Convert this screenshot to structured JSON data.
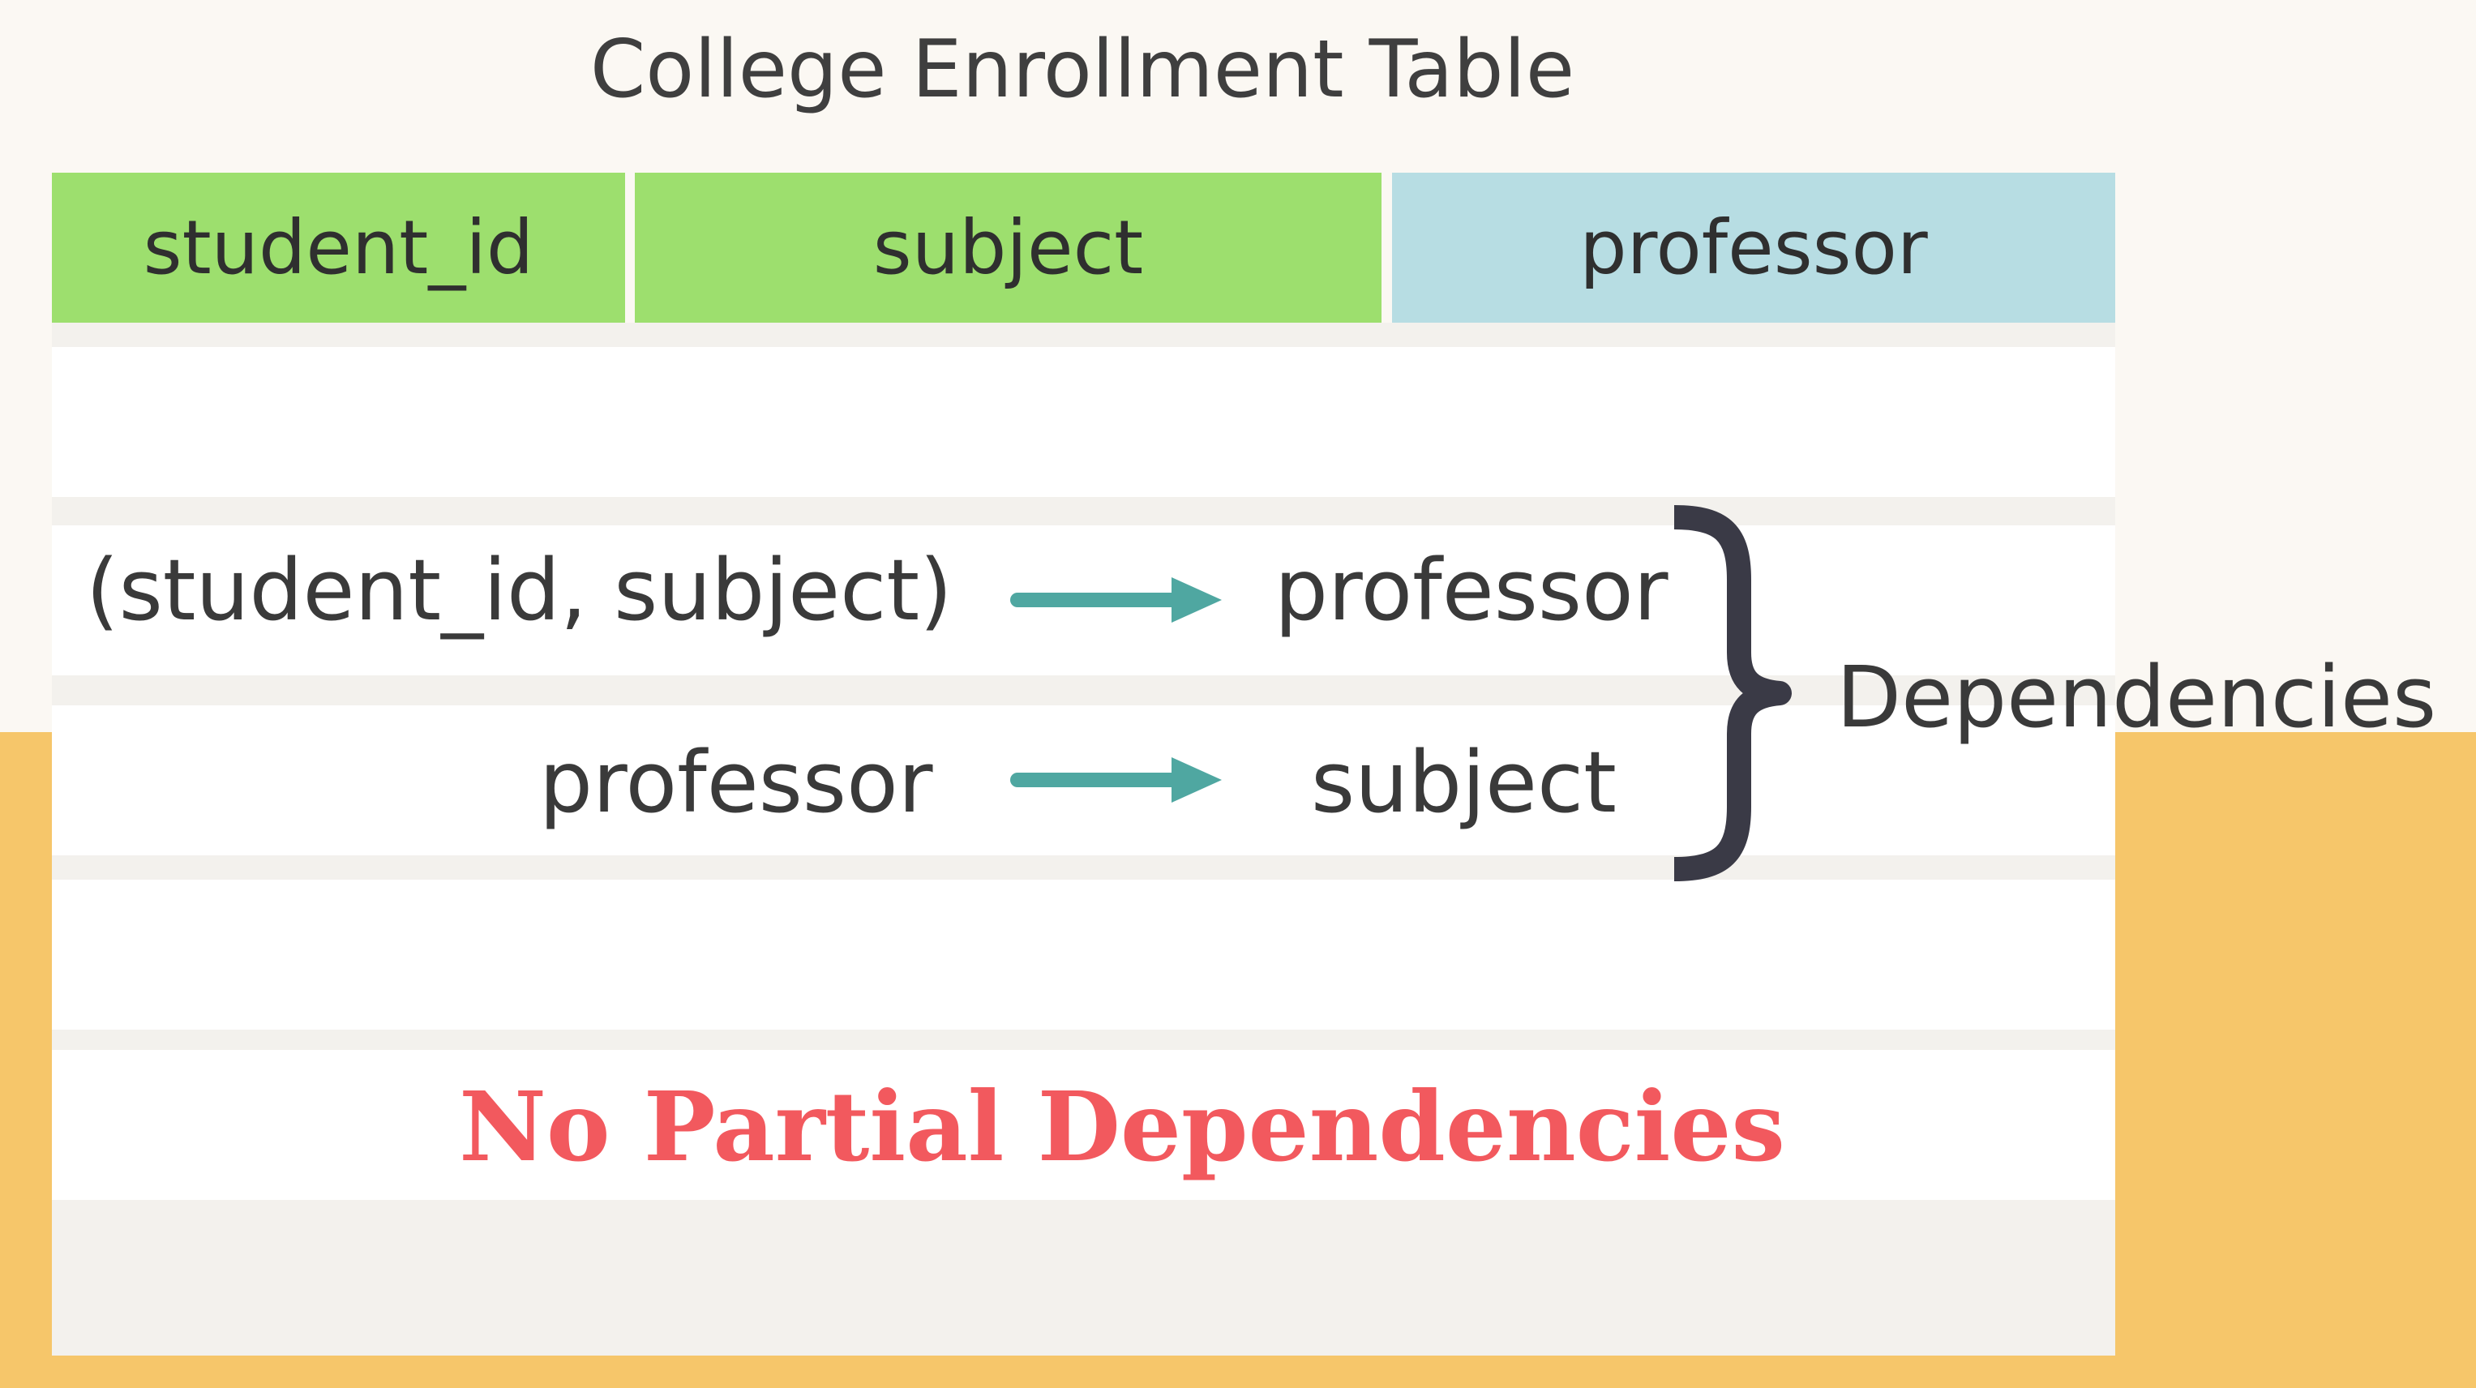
{
  "title": "College Enrollment Table",
  "columns": [
    {
      "label": "student_id",
      "key_part": true
    },
    {
      "label": "subject",
      "key_part": true
    },
    {
      "label": "professor",
      "key_part": false
    }
  ],
  "dependencies": [
    {
      "left": "(student_id, subject)",
      "right": "professor"
    },
    {
      "left": "professor",
      "right": "subject"
    }
  ],
  "brace_label": "Dependencies",
  "conclusion": "No Partial Dependencies",
  "colors": {
    "background_top": "#FBF8F3",
    "background_bottom": "#F6C66A",
    "key_header": "#9DDF6E",
    "nonkey_header": "#B7DDE3",
    "arrow": "#4FA7A1",
    "brace": "#3a3a46",
    "conclusion_text": "#F2595E"
  },
  "icons": {
    "arrow": "arrow-right-icon",
    "brace": "right-curly-brace-icon"
  }
}
